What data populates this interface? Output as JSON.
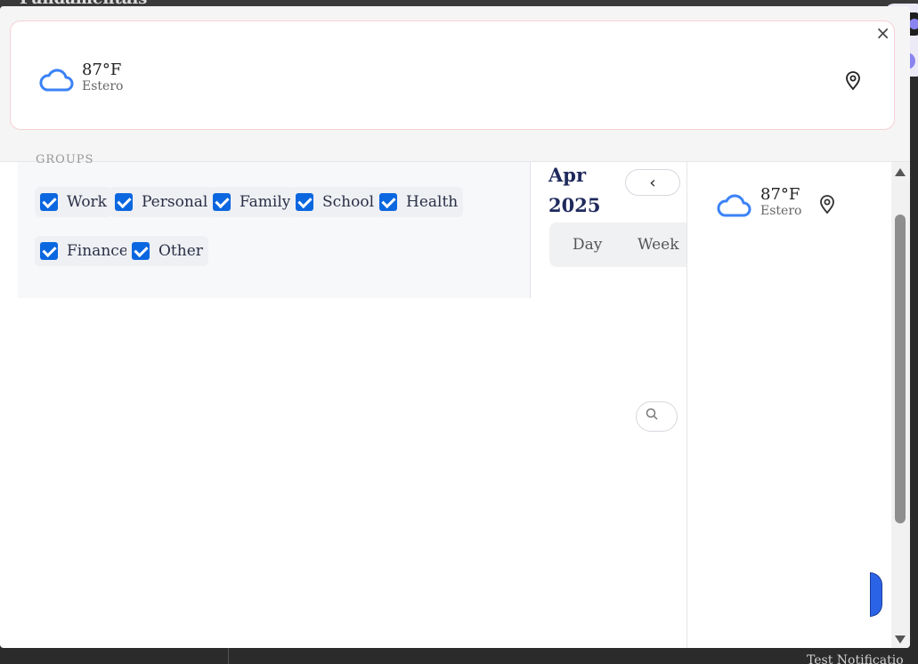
{
  "background": {
    "title": "Fundamentals",
    "notification": "Test Notificatio"
  },
  "modal": {
    "close_label": "×",
    "weather_main": {
      "temperature": "87°F",
      "location": "Estero",
      "icon": "cloud-icon"
    },
    "groups": {
      "heading": "GROUPS",
      "items": [
        {
          "label": "Work",
          "checked": true
        },
        {
          "label": "Personal",
          "checked": true
        },
        {
          "label": "Family",
          "checked": true
        },
        {
          "label": "School",
          "checked": true
        },
        {
          "label": "Health",
          "checked": true
        },
        {
          "label": "Finance",
          "checked": true
        },
        {
          "label": "Other",
          "checked": true
        }
      ]
    },
    "calendar": {
      "month": "Apr",
      "year": "2025",
      "prev_label": "‹",
      "views": [
        "Day",
        "Week"
      ]
    },
    "weather_side": {
      "temperature": "87°F",
      "location": "Estero",
      "icon": "cloud-icon"
    }
  },
  "colors": {
    "accent": "#0b67e0",
    "cloud": "#3b82f6",
    "title": "#1f2a5c"
  }
}
